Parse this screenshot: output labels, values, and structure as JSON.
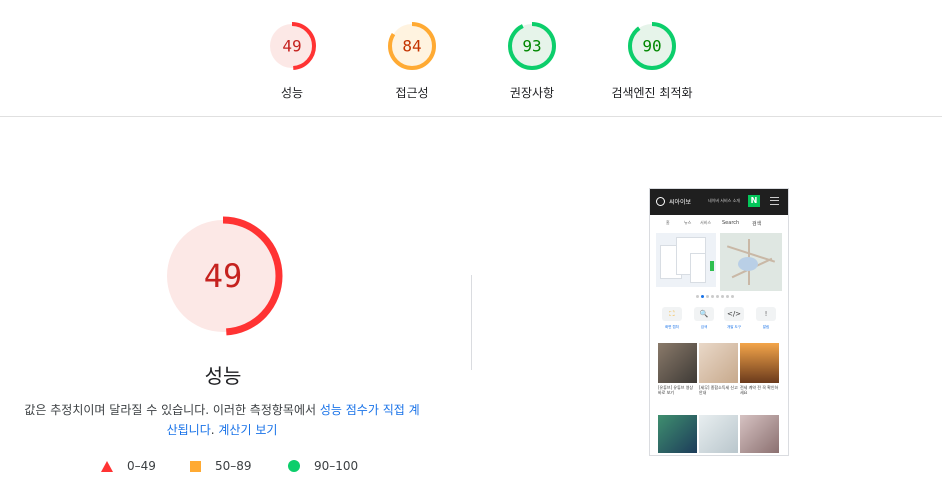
{
  "scores": [
    {
      "value": "49",
      "label": "성능",
      "fraction": 0.49,
      "color": "#ff3333",
      "text_color": "#c5221f",
      "bg": "#fce8e6"
    },
    {
      "value": "84",
      "label": "접근성",
      "fraction": 0.84,
      "color": "#ffaa33",
      "text_color": "#c33300",
      "bg": "#fff3e0"
    },
    {
      "value": "93",
      "label": "권장사항",
      "fraction": 0.93,
      "color": "#0cce6b",
      "text_color": "#008800",
      "bg": "#e6f4ea"
    },
    {
      "value": "90",
      "label": "검색엔진 최적화",
      "fraction": 0.9,
      "color": "#0cce6b",
      "text_color": "#008800",
      "bg": "#e6f4ea"
    }
  ],
  "main": {
    "score": "49",
    "fraction": 0.49,
    "title": "성능",
    "description_part1": "값은 추정치이며 달라질 수 있습니다. 이러한 측정항목에서 ",
    "description_link1": "성능 점수가 직접 계산됩니다",
    "description_part2": ". ",
    "description_link2": "계산기 보기"
  },
  "legend": [
    {
      "range": "0–49",
      "shape": "triangle-icon",
      "color": "#ff3333"
    },
    {
      "range": "50–89",
      "shape": "square-icon",
      "color": "#ffaa33"
    },
    {
      "range": "90–100",
      "shape": "circle-icon",
      "color": "#0cce6b"
    }
  ],
  "preview": {
    "brand": "씨아이보",
    "header_right": "네이버 서비스 소개",
    "nav": [
      "홈",
      "뉴스",
      "서비스"
    ],
    "search": "Search",
    "search_label": "검색",
    "icons": [
      {
        "glyph": "⛶",
        "label": "화면 캡처"
      },
      {
        "glyph": "🔍",
        "label": "검색"
      },
      {
        "glyph": "</>",
        "label": "개발 도구"
      },
      {
        "glyph": "!",
        "label": "알림"
      }
    ],
    "captions": [
      "[유튜브] 유튜브 영상 바로 보기",
      "[세무] 종합소득세 신고 안내",
      "전세 계약 전 꼭 확인하세요"
    ]
  }
}
